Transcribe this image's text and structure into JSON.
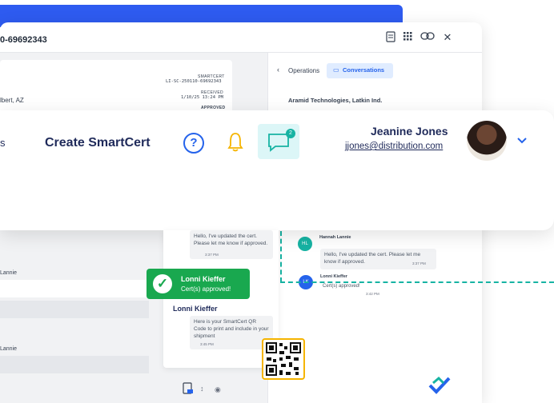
{
  "window": {
    "doc_id": "0-69692343",
    "toolbar_icons": [
      "document-icon",
      "grid-icon",
      "link-icon",
      "close-icon"
    ],
    "close_label": "✕"
  },
  "doc_card": {
    "smartcert_label": "SMARTCERT",
    "smartcert_id": "LI-SC-250110-69692343",
    "received_label": "RECEIVED",
    "received_time": "1/10/25 13:24 PM",
    "status": "APPROVED",
    "location": "lbert, AZ"
  },
  "right_pane": {
    "breadcrumb": "Operations",
    "tab": "Conversations",
    "company": "Aramid Technologies, Latkin Ind.",
    "messages": [
      {
        "initials": "HL",
        "name": "Hannah Lannie",
        "text": "Hello, I've updated the cert. Please let me know if approved.",
        "time": "3:37 PM"
      },
      {
        "initials": "LK",
        "name": "Lonni Kieffer",
        "text": "Cert(s) approved!",
        "time": "3:42 PM"
      }
    ]
  },
  "header": {
    "nav_partial": "s",
    "create_label": "Create SmartCert",
    "help": "?",
    "chat_badge": "2",
    "user_name": "Jeanine Jones",
    "user_email": "jjones@distribution.com",
    "colors": {
      "brand_navy": "#1f2a5a",
      "accent": "#2563eb",
      "teal": "#17b3a3"
    }
  },
  "chat_panel": {
    "first_bubble": "Hello, I've updated the cert. Please let me know if approved.",
    "first_time": "3:37 PM",
    "sender": "Lonni Kieffer",
    "second_bubble": "Here is your SmartCert QR Code to print and include in your shipment",
    "second_time": "3:45 PM"
  },
  "toast": {
    "name": "Lonni Kieffer",
    "message": "Cert(s) approved!"
  },
  "left_list": {
    "label_1": "Lannie",
    "label_2": "Lannie"
  }
}
